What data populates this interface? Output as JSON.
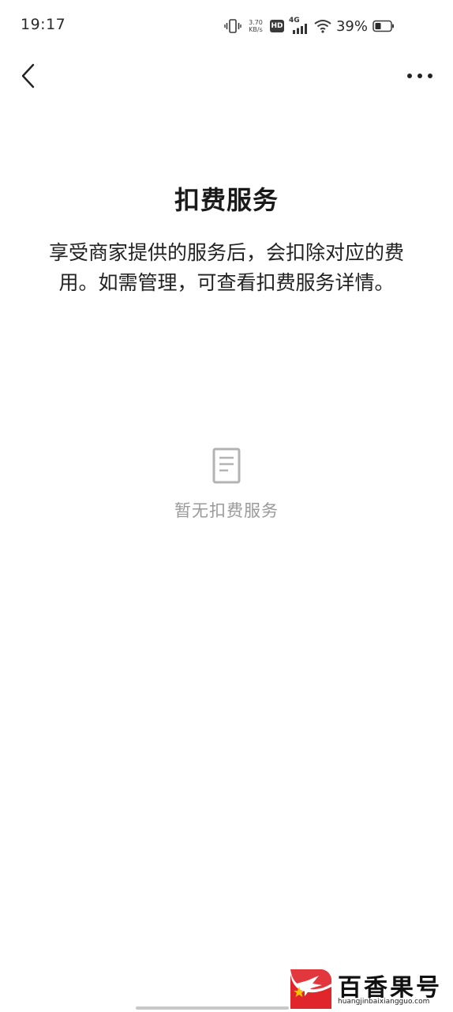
{
  "status_bar": {
    "time": "19:17",
    "net_speed_value": "3.70",
    "net_speed_unit": "KB/s",
    "hd_label": "HD",
    "network_type": "4G",
    "battery_percent": "39%",
    "icons": [
      "vibrate-icon",
      "signal-icon",
      "wifi-icon",
      "battery-icon"
    ]
  },
  "nav": {
    "back_icon": "chevron-left-icon",
    "more_icon": "more-dots-icon"
  },
  "main": {
    "title": "扣费服务",
    "description": "享受商家提供的服务后，会扣除对应的费用。如需管理，可查看扣费服务详情。",
    "empty_icon": "document-icon",
    "empty_text": "暂无扣费服务"
  },
  "watermark": {
    "name": "百香果号",
    "url": "huangjinbaixiangguo.com",
    "logo_color": "#e0262b"
  },
  "colors": {
    "background": "#ffffff",
    "text_primary": "#1a1a1a",
    "text_muted": "#9a9a9a",
    "icon_muted": "#b3b3b3"
  }
}
